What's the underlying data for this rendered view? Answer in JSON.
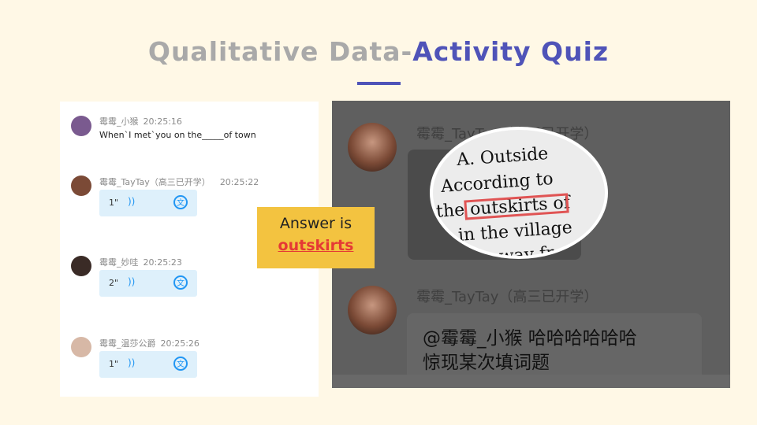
{
  "title": {
    "part1": "Qualitative Data-",
    "part2": "Activity Quiz",
    "accent_color": "#4f53b8",
    "muted_color": "#a9a9a9"
  },
  "left_chat": {
    "messages": [
      {
        "name": "霉霉_小猴",
        "time": "20:25:16",
        "text": "When`I met`you on the_____of town"
      },
      {
        "name": "霉霉_TayTay（高三已开学）",
        "time": "20:25:22",
        "voice_duration": "1\""
      },
      {
        "name": "霉霉_妙哇",
        "time": "20:25:23",
        "voice_duration": "2\""
      },
      {
        "name": "霉霉_温莎公爵",
        "time": "20:25:26",
        "voice_duration": "1\""
      }
    ],
    "voice_wave_icon": "))",
    "translate_icon": "文"
  },
  "answer_box": {
    "line1": "Answer is",
    "line2": "outskirts",
    "bg_color": "#f3c340",
    "highlight_color": "#e53935"
  },
  "right_chat": {
    "sender1": "霉霉_TayTay（高三已开学）",
    "zoom_lines": [
      "A. Outside",
      "According to",
      "the outskirts of",
      "A. in the village",
      "far away fro"
    ],
    "sender2": "霉霉_TayTay（高三已开学）",
    "reply_line1": "@霉霉_小猴 哈哈哈哈哈哈",
    "reply_line2": "惊现某次填词题"
  }
}
